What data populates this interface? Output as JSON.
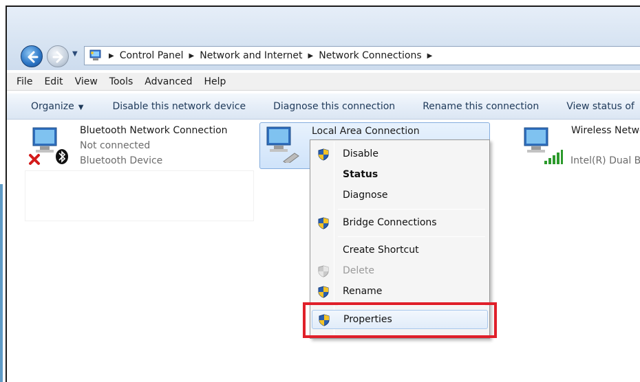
{
  "address_bar": {
    "breadcrumbs": [
      "Control Panel",
      "Network and Internet",
      "Network Connections"
    ]
  },
  "menu_bar": {
    "items": [
      "File",
      "Edit",
      "View",
      "Tools",
      "Advanced",
      "Help"
    ]
  },
  "command_bar": {
    "organize": "Organize",
    "items": [
      "Disable this network device",
      "Diagnose this connection",
      "Rename this connection",
      "View status of"
    ]
  },
  "connections": {
    "bluetooth": {
      "name": "Bluetooth Network Connection",
      "status": "Not connected",
      "device": "Bluetooth Device",
      "icon": "network-computer-icon"
    },
    "lan": {
      "name": "Local Area Connection",
      "icon": "network-computer-icon"
    },
    "wireless": {
      "name": "Wireless Netwo",
      "device": "Intel(R) Dual B",
      "icon": "network-computer-icon"
    }
  },
  "context_menu": {
    "items": [
      {
        "label": "Disable",
        "shield": true,
        "bold": false,
        "disabled": false
      },
      {
        "label": "Status",
        "shield": false,
        "bold": true,
        "disabled": false
      },
      {
        "label": "Diagnose",
        "shield": false,
        "bold": false,
        "disabled": false
      },
      {
        "label": "Bridge Connections",
        "shield": true,
        "bold": false,
        "disabled": false
      },
      {
        "label": "Create Shortcut",
        "shield": false,
        "bold": false,
        "disabled": false
      },
      {
        "label": "Delete",
        "shield": true,
        "bold": false,
        "disabled": true
      },
      {
        "label": "Rename",
        "shield": true,
        "bold": false,
        "disabled": false
      },
      {
        "label": "Properties",
        "shield": true,
        "bold": false,
        "disabled": false,
        "highlighted": true
      }
    ]
  },
  "colors": {
    "annotation": "#e0202a",
    "selection": "#cfe3fa"
  }
}
